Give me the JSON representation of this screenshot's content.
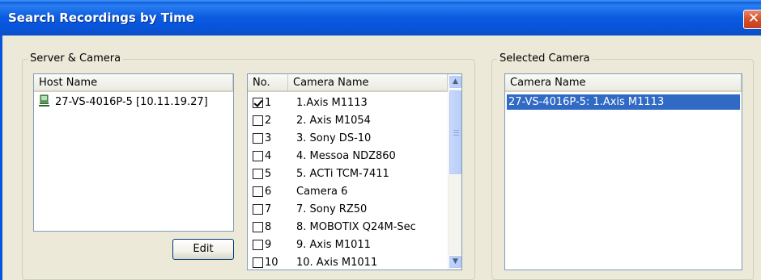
{
  "window": {
    "title": "Search Recordings by Time",
    "close_glyph": "✕"
  },
  "server_camera_group": {
    "legend": "Server & Camera",
    "host_list": {
      "header": "Host Name",
      "items": [
        {
          "label": "27-VS-4016P-5 [10.11.19.27]",
          "icon": "server-icon"
        }
      ]
    },
    "edit_button": "Edit",
    "camera_list": {
      "headers": {
        "no": "No.",
        "name": "Camera Name"
      },
      "rows": [
        {
          "no": "1",
          "name": "1.Axis M1113",
          "checked": true
        },
        {
          "no": "2",
          "name": "2. Axis M1054",
          "checked": false
        },
        {
          "no": "3",
          "name": "3. Sony DS-10",
          "checked": false
        },
        {
          "no": "4",
          "name": "4. Messoa NDZ860",
          "checked": false
        },
        {
          "no": "5",
          "name": "5. ACTi TCM-7411",
          "checked": false
        },
        {
          "no": "6",
          "name": "Camera 6",
          "checked": false
        },
        {
          "no": "7",
          "name": "7. Sony RZ50",
          "checked": false
        },
        {
          "no": "8",
          "name": "8. MOBOTIX Q24M-Sec",
          "checked": false
        },
        {
          "no": "9",
          "name": "9. Axis M1011",
          "checked": false
        },
        {
          "no": "10",
          "name": "10. Axis M1011",
          "checked": false
        }
      ]
    }
  },
  "selected_camera_group": {
    "legend": "Selected Camera",
    "header": "Camera Name",
    "items": [
      {
        "label": "27-VS-4016P-5: 1.Axis M1113",
        "selected": true
      }
    ]
  },
  "colors": {
    "title_bar": "#0855dd",
    "selection": "#316ac5",
    "window_bg": "#ece9d8"
  }
}
